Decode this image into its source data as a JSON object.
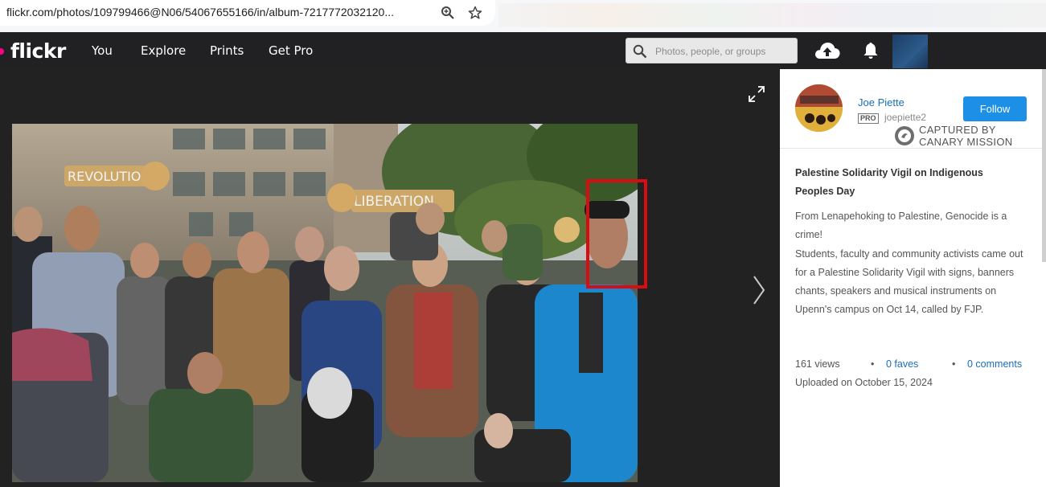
{
  "browser": {
    "url": "flickr.com/photos/109799466@N06/54067655166/in/album-7217772032120..."
  },
  "nav": {
    "logo": "flickr",
    "items": [
      "You",
      "Explore",
      "Prints",
      "Get Pro"
    ],
    "search_placeholder": "Photos, people, or groups"
  },
  "owner": {
    "name": "Joe Piette",
    "badge": "PRO",
    "handle": "joepiette2",
    "follow_label": "Follow"
  },
  "watermark": {
    "line1": "CAPTURED BY",
    "line2": "CANARY MISSION"
  },
  "photo": {
    "title": "Palestine Solidarity Vigil on Indigenous Peoples Day",
    "description": [
      "From Lenapehoking to Palestine, Genocide is a crime!",
      "Students, faculty and community activists came out for a Palestine Solidarity Vigil with signs, banners chants, speakers and musical instruments on Upenn's campus on Oct 14, called by FJP."
    ],
    "sign_texts": [
      "REVOLUTION",
      "LIBERATION"
    ]
  },
  "stats": {
    "views": "161 views",
    "faves": "0 faves",
    "comments": "0 comments",
    "separator": "•",
    "uploaded": "Uploaded on October 15, 2024"
  },
  "colors": {
    "nav_bg": "#212124",
    "stage_bg": "#222222",
    "accent": "#1c8fe6",
    "link": "#1a6eb8",
    "logo_dot": "#ff0084",
    "highlight": "#d80d14"
  }
}
